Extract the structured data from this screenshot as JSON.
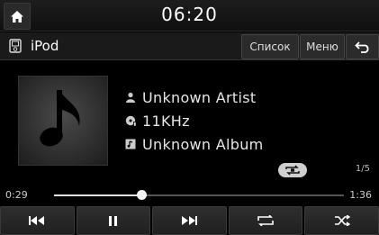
{
  "status_bar": {
    "clock": "06:20"
  },
  "title_bar": {
    "source_label": "iPod",
    "list_button": "Список",
    "menu_button": "Меню"
  },
  "track": {
    "artist": "Unknown Artist",
    "sample_rate": "11KHz",
    "album": "Unknown Album",
    "track_count": "1/5"
  },
  "progress": {
    "elapsed": "0:29",
    "total": "1:36",
    "fraction": 0.3
  },
  "controls": [
    "previous-icon",
    "pause-icon",
    "next-icon",
    "repeat-icon",
    "shuffle-icon"
  ],
  "colors": {
    "background": "#000000",
    "text": "#ffffff"
  }
}
